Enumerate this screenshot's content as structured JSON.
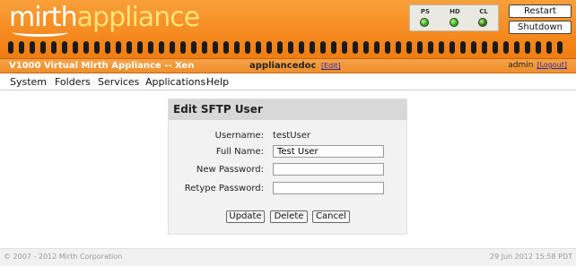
{
  "header": {
    "logo_part1": "mirth",
    "logo_part2": "appliance",
    "status_leds": [
      {
        "label": "PS",
        "color": "#3aa51e"
      },
      {
        "label": "HD",
        "color": "#3aa51e"
      },
      {
        "label": "CL",
        "color": "#3e6b1a"
      }
    ],
    "restart_label": "Restart",
    "shutdown_label": "Shutdown"
  },
  "infobar": {
    "appliance_name": "V1000 Virtual Mirth Appliance -- Xen",
    "hostname": "appliancedoc",
    "edit_label": "[Edit]",
    "username": "admin",
    "logout_label": "[Logout]"
  },
  "menu": [
    "System",
    "Folders",
    "Services",
    "Applications",
    "Help"
  ],
  "form": {
    "title": "Edit SFTP User",
    "username_label": "Username:",
    "username_value": "testUser",
    "fullname_label": "Full Name:",
    "fullname_value": "Test User",
    "new_password_label": "New Password:",
    "new_password_value": "",
    "retype_password_label": "Retype Password:",
    "retype_password_value": "",
    "update_label": "Update",
    "delete_label": "Delete",
    "cancel_label": "Cancel"
  },
  "footer": {
    "copyright": "© 2007 - 2012 Mirth Corporation",
    "datetime": "29 Jun 2012 15:58 PDT"
  },
  "colors": {
    "header_orange": "#f58a1f",
    "logo_accent": "#fbe37a",
    "link_blue": "#2a2ab0"
  }
}
